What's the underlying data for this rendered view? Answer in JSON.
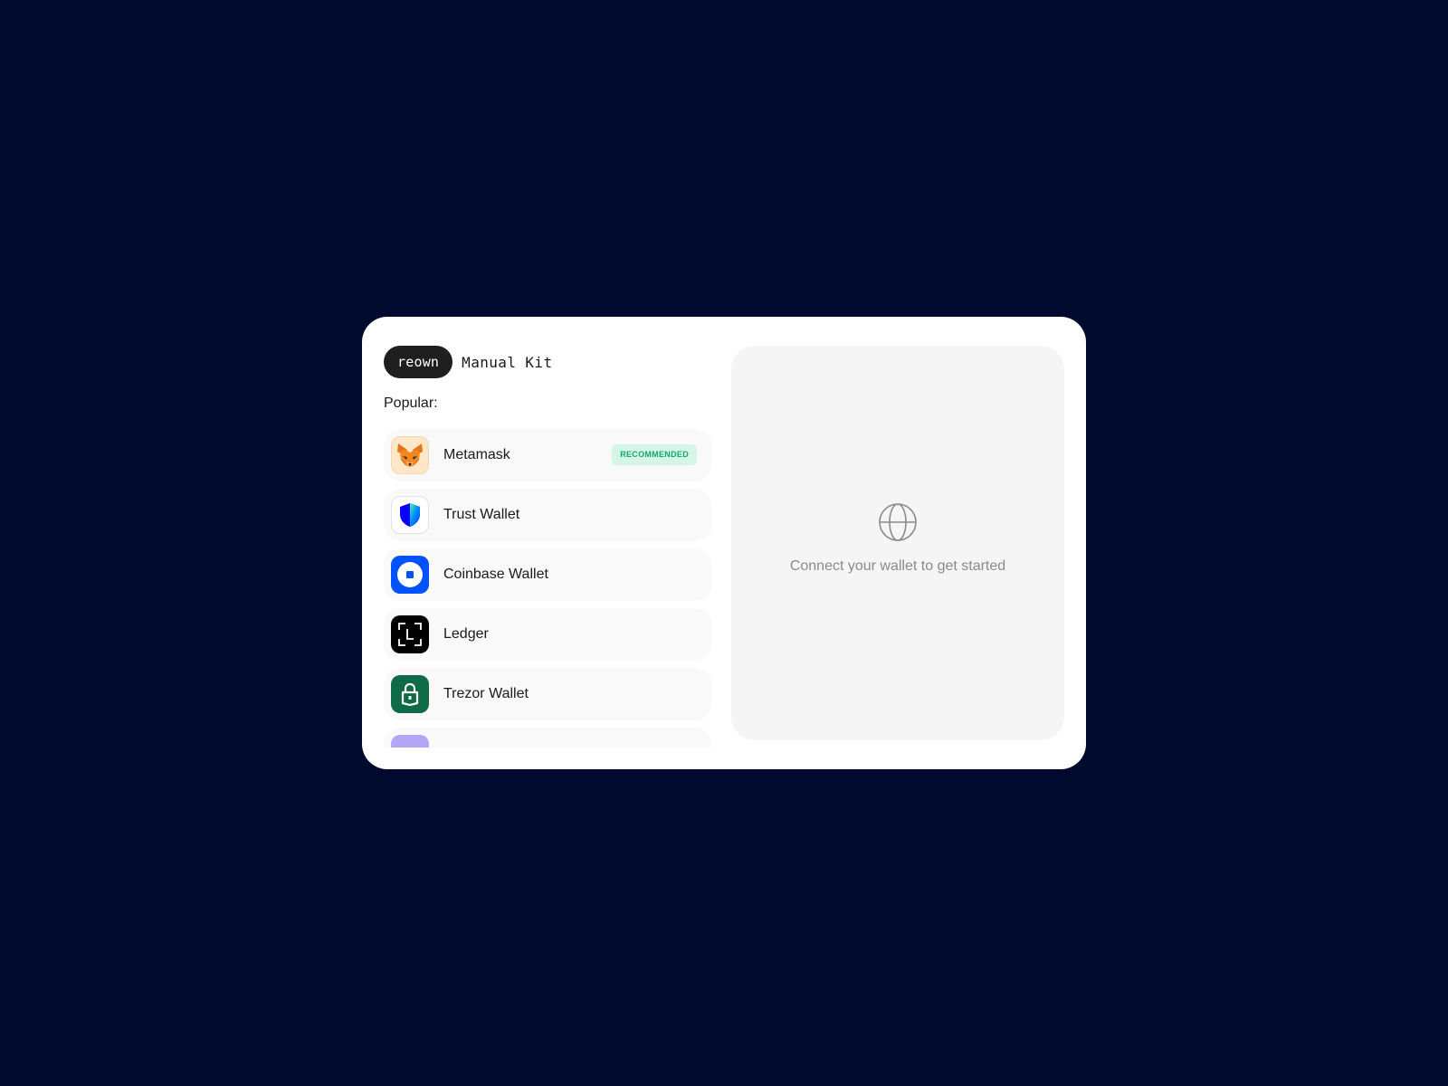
{
  "brand": {
    "name": "reown",
    "product": "Manual Kit"
  },
  "section_label": "Popular:",
  "wallets": [
    {
      "name": "Metamask",
      "badge": "RECOMMENDED",
      "icon": "metamask-fox-icon"
    },
    {
      "name": "Trust Wallet",
      "icon": "trust-wallet-shield-icon"
    },
    {
      "name": "Coinbase Wallet",
      "icon": "coinbase-icon"
    },
    {
      "name": "Ledger",
      "icon": "ledger-icon"
    },
    {
      "name": "Trezor Wallet",
      "icon": "trezor-lock-icon"
    },
    {
      "name": "",
      "icon": "wallet-icon"
    }
  ],
  "panel": {
    "icon": "globe-icon",
    "message": "Connect your wallet to get started"
  },
  "colors": {
    "page_background": "#000a2e",
    "badge_background": "#d4f5e7",
    "badge_text": "#13a86b",
    "coinbase_blue": "#0052ff",
    "trezor_green": "#0f6a48",
    "ledger_black": "#000000"
  }
}
